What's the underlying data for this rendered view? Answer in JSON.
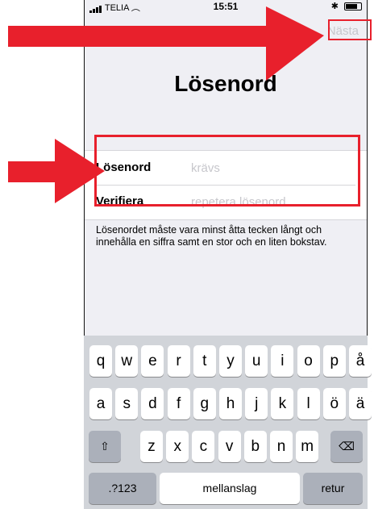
{
  "status": {
    "carrier": "TELIA",
    "time": "15:51",
    "bluetooth": "✱"
  },
  "nav": {
    "next_label": "Nästa"
  },
  "page": {
    "title": "Lösenord"
  },
  "form": {
    "password_label": "Lösenord",
    "password_placeholder": "krävs",
    "verify_label": "Verifiera",
    "verify_placeholder": "repetera lösenord"
  },
  "help_text": "Lösenordet måste vara minst åtta tecken långt och innehålla en siffra samt en stor och en liten bokstav.",
  "keyboard": {
    "row1": [
      "q",
      "w",
      "e",
      "r",
      "t",
      "y",
      "u",
      "i",
      "o",
      "p",
      "å"
    ],
    "row2": [
      "a",
      "s",
      "d",
      "f",
      "g",
      "h",
      "j",
      "k",
      "l",
      "ö",
      "ä"
    ],
    "row3": [
      "z",
      "x",
      "c",
      "v",
      "b",
      "n",
      "m"
    ],
    "numbers_label": ".?123",
    "space_label": "mellanslag",
    "return_label": "retur",
    "shift_icon": "⇧",
    "backspace_icon": "⌫"
  },
  "annotation_color": "#e8202c"
}
